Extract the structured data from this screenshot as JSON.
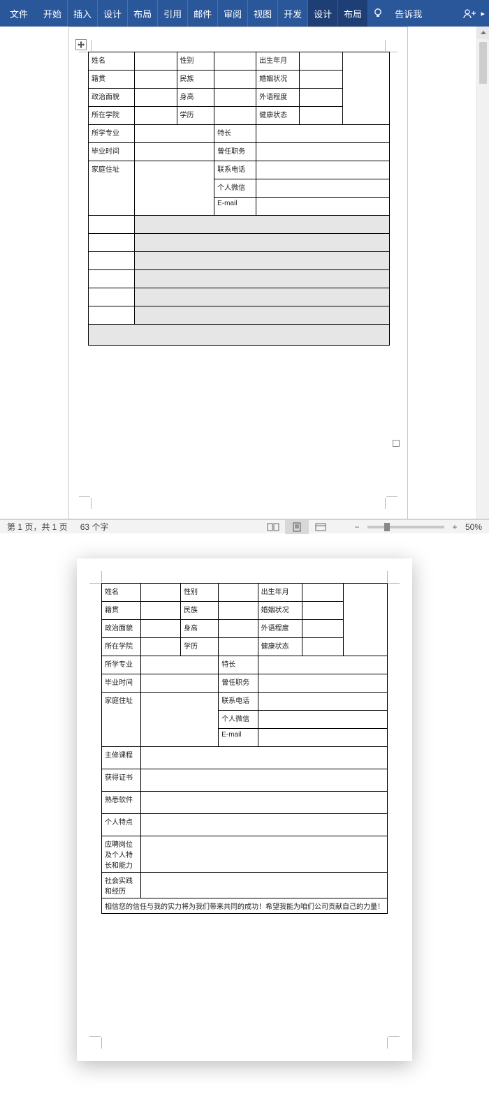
{
  "ribbon": {
    "tabs": [
      "文件",
      "开始",
      "插入",
      "设计",
      "布局",
      "引用",
      "邮件",
      "审阅",
      "视图",
      "开发",
      "设计",
      "布局"
    ],
    "active_indices": [
      10,
      11
    ],
    "tell_me": "告诉我"
  },
  "statusbar": {
    "page_info": "第 1 页，共 1 页",
    "word_count": "63 个字",
    "zoom_percent": "50%"
  },
  "form": {
    "r1": {
      "name": "姓名",
      "gender": "性别",
      "dob": "出生年月"
    },
    "r2": {
      "native": "籍贯",
      "ethnic": "民族",
      "marital": "婚姻状况"
    },
    "r3": {
      "politics": "政治面貌",
      "height": "身高",
      "foreign": "外语程度"
    },
    "r4": {
      "college": "所在学院",
      "edu": "学历",
      "health": "健康状态"
    },
    "r5": {
      "major": "所学专业",
      "specialty": "特长"
    },
    "r6": {
      "gradtime": "毕业时间",
      "position": "曾任职务"
    },
    "r7": {
      "address": "家庭住址",
      "phone": "联系电话",
      "wechat": "个人微信",
      "email": "E-mail"
    },
    "sections": {
      "courses": "主修课程",
      "certs": "获得证书",
      "software": "熟悉软件",
      "personality": "个人特点",
      "job_l1": "应聘岗位",
      "job_l2": "及个人特",
      "job_l3": "长和能力",
      "social_l1": "社会实践",
      "social_l2": "和经历"
    },
    "closing": "相信您的信任与我的实力将为我们带来共同的成功！希望我能为咱们公司贡献自己的力量！"
  }
}
